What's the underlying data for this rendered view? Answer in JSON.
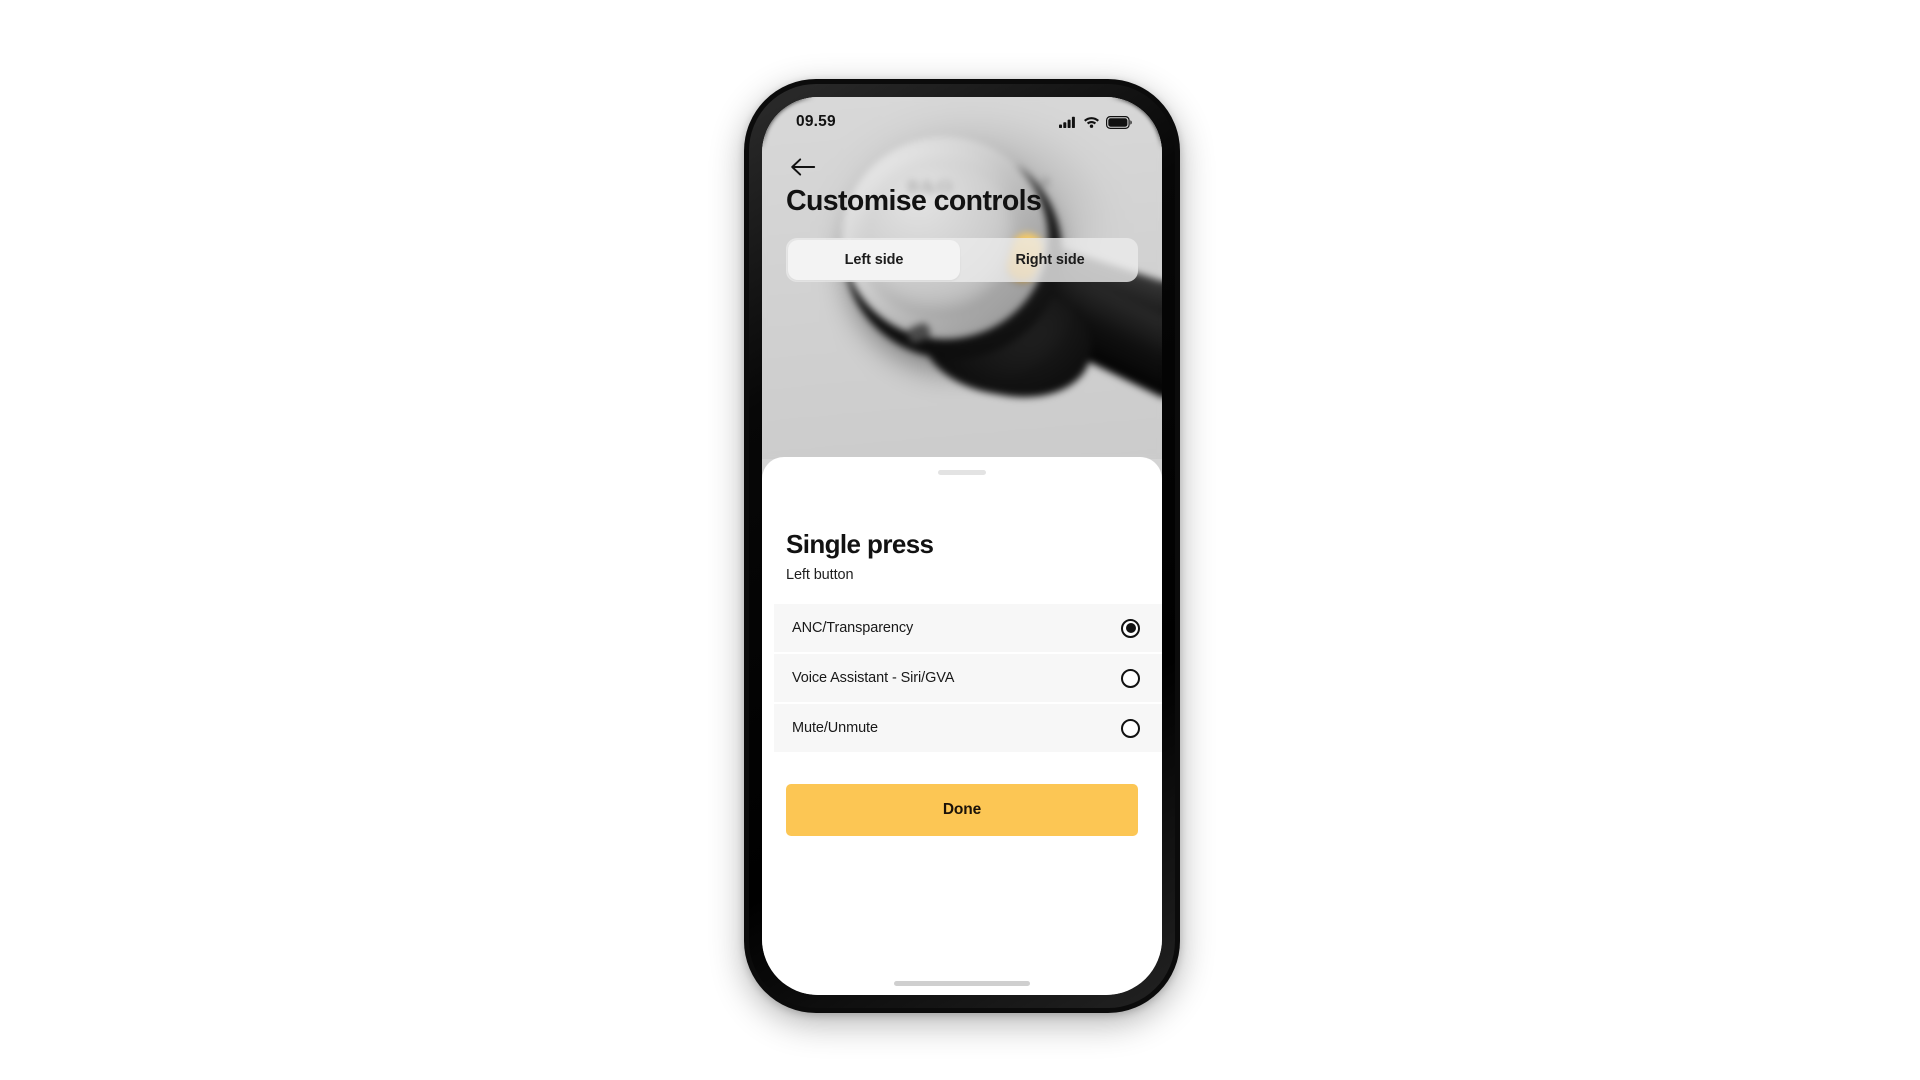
{
  "status_bar": {
    "time": "09.59",
    "icons": [
      "cellular-signal-icon",
      "wifi-icon",
      "battery-icon"
    ]
  },
  "header": {
    "back_icon": "back-arrow-icon",
    "title": "Customise controls"
  },
  "segmented_control": {
    "selected": "Left side",
    "tabs": [
      {
        "label": "Left side",
        "active": true
      },
      {
        "label": "Right side",
        "active": false
      }
    ]
  },
  "hero": {
    "product_logo": "B&O",
    "alt": "blurred photo of over-ear headphones with silver earcup and amber button"
  },
  "sheet": {
    "handle": "drag-handle",
    "title": "Single press",
    "subtitle": "Left button",
    "options": [
      {
        "label": "ANC/Transparency",
        "selected": true
      },
      {
        "label": "Voice Assistant - Siri/GVA",
        "selected": false
      },
      {
        "label": "Mute/Unmute",
        "selected": false
      }
    ],
    "primary_action": "Done"
  },
  "colors": {
    "accent": "#fcc654",
    "row_background": "#f7f7f7",
    "sheet_background": "#ffffff",
    "hero_background": "#d4d4d4",
    "text_primary": "#121212"
  }
}
